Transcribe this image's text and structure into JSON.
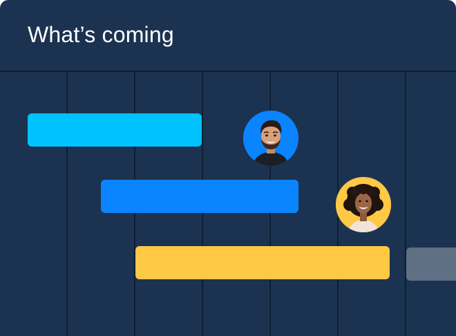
{
  "card": {
    "title": "What’s coming"
  },
  "colors": {
    "background": "#1b3350",
    "grid_line": "#0e1f33",
    "bar_cyan": "#00c2ff",
    "bar_blue": "#0a84ff",
    "bar_yellow": "#ffc845",
    "bar_gray": "#5f7085",
    "avatar_1_ring": "#0a84ff",
    "avatar_2_ring": "#ffc845"
  },
  "timeline": {
    "bars": [
      {
        "name": "timeline-bar-cyan",
        "color": "#00c2ff"
      },
      {
        "name": "timeline-bar-blue",
        "color": "#0a84ff"
      },
      {
        "name": "timeline-bar-yellow",
        "color": "#ffc845"
      },
      {
        "name": "timeline-bar-gray",
        "color": "#5f7085"
      }
    ],
    "avatars": [
      {
        "name": "avatar-man",
        "ring_color": "#0a84ff"
      },
      {
        "name": "avatar-woman",
        "ring_color": "#ffc845"
      }
    ]
  }
}
